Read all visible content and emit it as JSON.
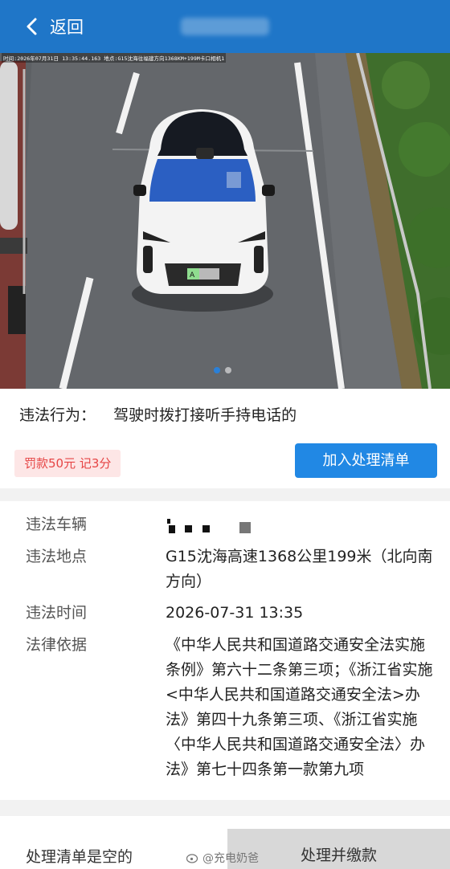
{
  "header": {
    "back_label": "返回",
    "title": ""
  },
  "photo": {
    "caption": "时间:2026年07月31日  13:35:44.163  地点:G15沈海往福建方向1368KM+199M卡口相机1",
    "page_count": 2,
    "active_page": 1
  },
  "violation": {
    "label": "违法行为：",
    "value": "驾驶时拨打接听手持电话的",
    "fine_badge": "罚款50元 记3分",
    "add_button": "加入处理清单"
  },
  "details": {
    "vehicle_label": "违法车辆",
    "vehicle_value": "",
    "location_label": "违法地点",
    "location_value": "G15沈海高速1368公里199米（北向南方向）",
    "time_label": "违法时间",
    "time_value": "2026-07-31 13:35",
    "legal_label": "法律依据",
    "legal_value": "《中华人民共和国道路交通安全法实施条例》第六十二条第三项；《浙江省实施<中华人民共和国道路交通安全法>办法》第四十九条第三项、《浙江省实施〈中华人民共和国道路交通安全法〉办法》第七十四条第一款第九项"
  },
  "footer": {
    "empty_text": "处理清单是空的",
    "pay_button": "处理并缴款",
    "watermark": "@充电奶爸"
  },
  "colors": {
    "header_bg": "#1f76c8",
    "primary_button": "#2188e4",
    "fine_text": "#e64545",
    "fine_bg": "#fde6e6"
  }
}
